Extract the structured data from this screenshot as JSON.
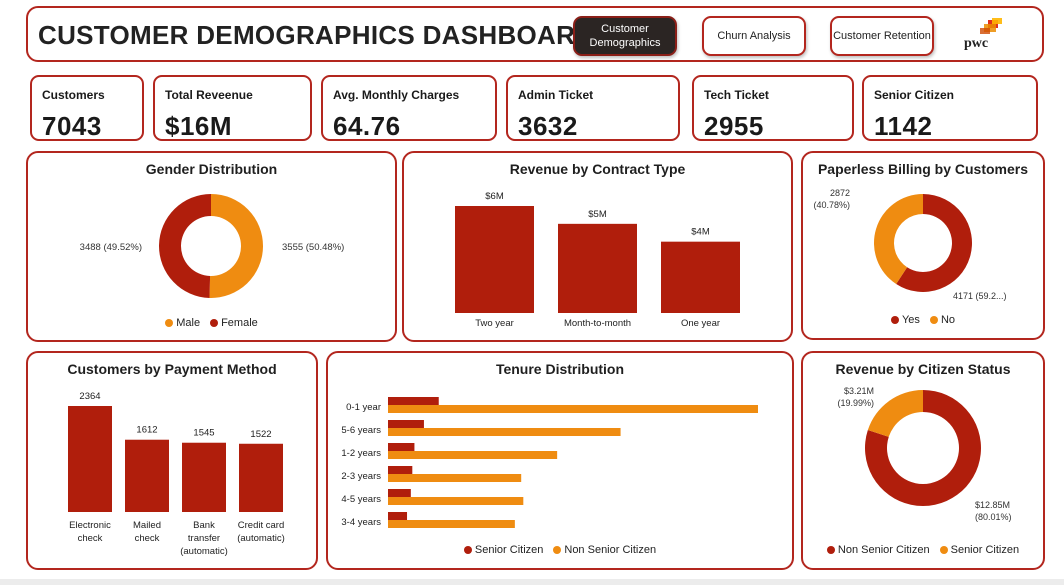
{
  "header": {
    "title": "CUSTOMER DEMOGRAPHICS DASHBOARD",
    "nav": [
      {
        "label": "Customer Demographics",
        "active": true
      },
      {
        "label": "Churn Analysis",
        "active": false
      },
      {
        "label": "Customer Retention",
        "active": false
      }
    ],
    "logo_text": "pwc"
  },
  "kpis": [
    {
      "label": "Customers",
      "value": "7043"
    },
    {
      "label": "Total Reveenue",
      "value": "$16M"
    },
    {
      "label": "Avg. Monthly Charges",
      "value": "64.76"
    },
    {
      "label": "Admin Ticket",
      "value": "3632"
    },
    {
      "label": "Tech Ticket",
      "value": "2955"
    },
    {
      "label": "Senior Citizen",
      "value": "1142"
    }
  ],
  "colors": {
    "primary": "#b01e0c",
    "secondary": "#ef8c11",
    "border": "#b3261e"
  },
  "chart_data": [
    {
      "id": "gender",
      "type": "pie",
      "title": "Gender Distribution",
      "slices": [
        {
          "name": "Male",
          "value": 3555,
          "label": "3555 (50.48%)",
          "color": "#ef8c11"
        },
        {
          "name": "Female",
          "value": 3488,
          "label": "3488 (49.52%)",
          "color": "#b01e0c"
        }
      ],
      "legend": [
        "Male",
        "Female"
      ],
      "legend_position": "bottom"
    },
    {
      "id": "contract",
      "type": "bar",
      "title": "Revenue by Contract Type",
      "categories": [
        "Two year",
        "Month-to-month",
        "One year"
      ],
      "values": [
        6,
        5,
        4
      ],
      "data_labels": [
        "$6M",
        "$5M",
        "$4M"
      ],
      "unit": "$M",
      "ylim": [
        0,
        6
      ]
    },
    {
      "id": "paperless",
      "type": "pie",
      "title": "Paperless Billing by Customers",
      "slices": [
        {
          "name": "Yes",
          "value": 4171,
          "label": "4171 (59.2...)",
          "color": "#b01e0c"
        },
        {
          "name": "No",
          "value": 2872,
          "label_line1": "2872",
          "label_line2": "(40.78%)",
          "color": "#ef8c11"
        }
      ],
      "legend": [
        "Yes",
        "No"
      ],
      "legend_position": "bottom"
    },
    {
      "id": "payment",
      "type": "bar",
      "title": "Customers by Payment Method",
      "categories": [
        [
          "Electronic",
          "check"
        ],
        [
          "Mailed",
          "check"
        ],
        [
          "Bank",
          "transfer",
          "(automatic)"
        ],
        [
          "Credit card",
          "(automatic)"
        ]
      ],
      "values": [
        2364,
        1612,
        1545,
        1522
      ],
      "data_labels": [
        "2364",
        "1612",
        "1545",
        "1522"
      ],
      "ylim": [
        0,
        2364
      ]
    },
    {
      "id": "tenure",
      "type": "bar",
      "orientation": "horizontal",
      "title": "Tenure Distribution",
      "categories": [
        "0-1 year",
        "5-6 years",
        "1-2 years",
        "2-3 years",
        "4-5 years",
        "3-4 years"
      ],
      "series": [
        {
          "name": "Senior Citizen",
          "values": [
            240,
            170,
            125,
            115,
            108,
            90
          ],
          "color": "#b01e0c"
        },
        {
          "name": "Non Senior Citizen",
          "values": [
            1750,
            1100,
            800,
            630,
            640,
            600
          ],
          "color": "#ef8c11"
        }
      ],
      "xlim": [
        0,
        1750
      ],
      "legend_position": "bottom"
    },
    {
      "id": "citizen_revenue",
      "type": "pie",
      "title": "Revenue by Citizen Status",
      "slices": [
        {
          "name": "Non Senior Citizen",
          "value": 12.85,
          "label_line1": "$12.85M",
          "label_line2": "(80.01%)",
          "color": "#b01e0c"
        },
        {
          "name": "Senior Citizen",
          "value": 3.21,
          "label_line1": "$3.21M",
          "label_line2": "(19.99%)",
          "color": "#ef8c11"
        }
      ],
      "legend": [
        "Non Senior Citizen",
        "Senior Citizen"
      ],
      "legend_position": "bottom"
    }
  ]
}
